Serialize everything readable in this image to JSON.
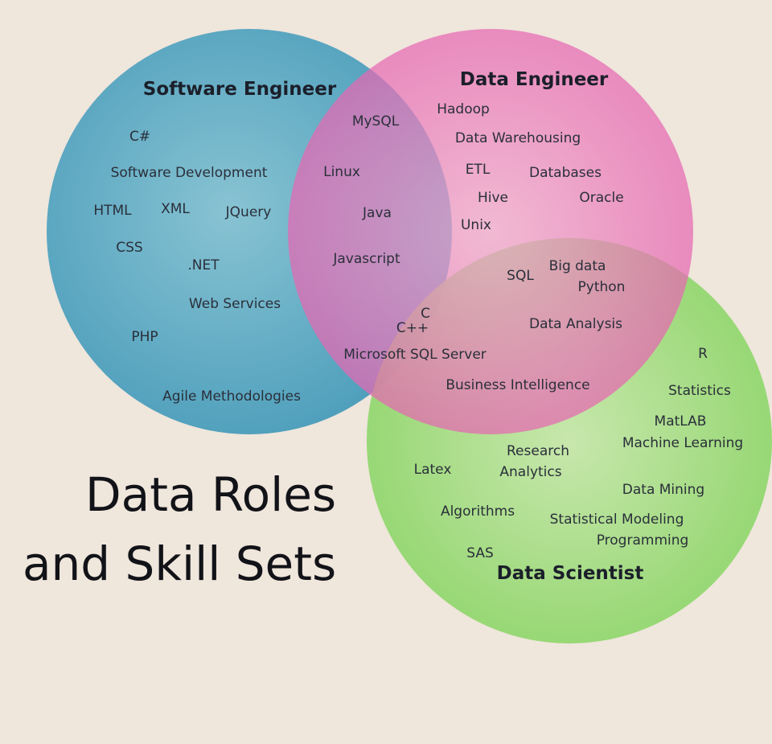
{
  "title": {
    "line1": "Data Roles",
    "line2": "and Skill Sets"
  },
  "roles": {
    "software_engineer": "Software Engineer",
    "data_engineer": "Data Engineer",
    "data_scientist": "Data Scientist"
  },
  "colors": {
    "software_engineer": "#4aa2c0",
    "data_engineer": "#e869b4",
    "data_scientist": "#8bd868",
    "background": "#efe6dc"
  },
  "skills": {
    "software_engineer_only": [
      "C#",
      "Software Development",
      "HTML",
      "XML",
      "JQuery",
      "CSS",
      ".NET",
      "Web Services",
      "PHP",
      "Agile Methodologies"
    ],
    "software_and_data_engineer": [
      "MySQL",
      "Linux",
      "Java",
      "Javascript"
    ],
    "all_three": [
      "C",
      "C++",
      "Microsoft SQL Server"
    ],
    "data_engineer_only": [
      "Hadoop",
      "Data Warehousing",
      "ETL",
      "Databases",
      "Hive",
      "Oracle",
      "Unix"
    ],
    "data_engineer_and_scientist": [
      "SQL",
      "Big data",
      "Python",
      "Data Analysis",
      "Business Intelligence"
    ],
    "data_scientist_only": [
      "R",
      "Statistics",
      "MatLAB",
      "Machine Learning",
      "Research",
      "Analytics",
      "Latex",
      "Data Mining",
      "Algorithms",
      "Statistical Modeling",
      "Programming",
      "SAS"
    ]
  }
}
